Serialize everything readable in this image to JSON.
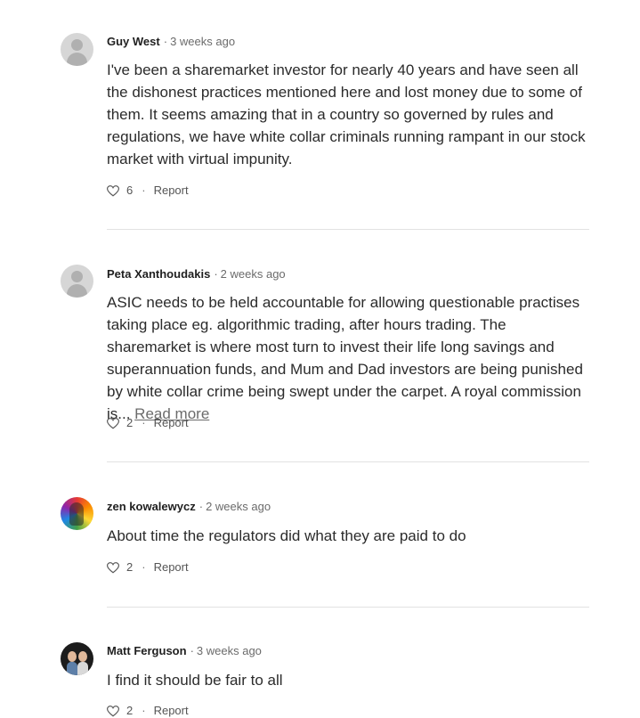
{
  "comments": [
    {
      "author": "Guy West",
      "separator": "·",
      "time": "3 weeks ago",
      "body": "I've been a sharemarket investor for nearly 40 years and have seen all the dishonest practices mentioned here and lost money due to some of them. It seems amazing that in a country so governed by rules and regulations, we have white collar criminals running rampant in our stock market with virtual impunity.",
      "read_more": "",
      "likes": "6",
      "action_separator": "·",
      "report": "Report"
    },
    {
      "author": "Peta Xanthoudakis",
      "separator": "·",
      "time": "2 weeks ago",
      "body": "ASIC needs to be held accountable for allowing questionable practises taking place eg. algorithmic trading, after hours trading. The sharemarket is where most turn to invest their life long savings and superannuation funds, and Mum and Dad investors are being punished by white collar crime being swept under the carpet. A royal commission is... ",
      "read_more": "Read more",
      "likes": "2",
      "action_separator": "·",
      "report": "Report"
    },
    {
      "author": "zen kowalewycz",
      "separator": "·",
      "time": "2 weeks ago",
      "body": "About time the regulators did what they are paid to do",
      "read_more": "",
      "likes": "2",
      "action_separator": "·",
      "report": "Report"
    },
    {
      "author": "Matt Ferguson",
      "separator": "·",
      "time": "3 weeks ago",
      "body": "I find it should be fair to all",
      "read_more": "",
      "likes": "2",
      "action_separator": "·",
      "report": "Report"
    }
  ],
  "icons": {
    "avatars": [
      "default-avatar-icon",
      "default-avatar-icon",
      "rainbow-avatar-icon",
      "photo-avatar-icon"
    ],
    "like": "heart-icon"
  },
  "colors": {
    "text": "#2b2b2b",
    "muted": "#6b6b6b",
    "divider": "#e2e2e2"
  }
}
